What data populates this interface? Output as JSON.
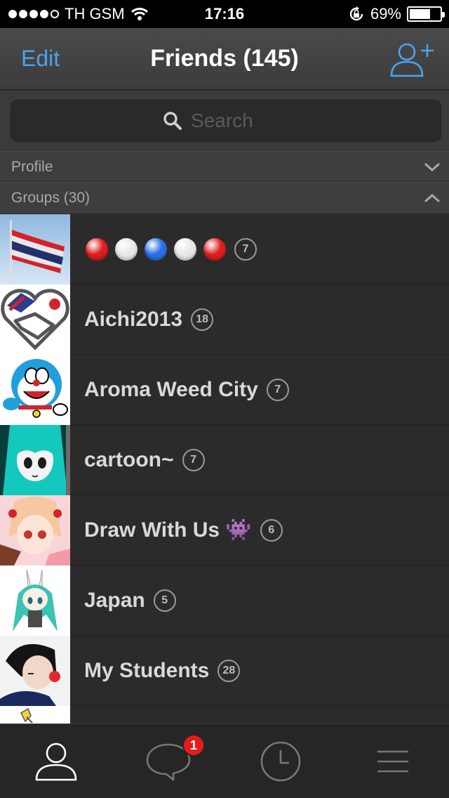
{
  "status_bar": {
    "carrier": "TH GSM",
    "time": "17:16",
    "battery_percent_label": "69%",
    "battery_level": 0.69
  },
  "navbar": {
    "edit_label": "Edit",
    "title": "Friends (145)",
    "add_friend_icon": "add-person-icon"
  },
  "search": {
    "placeholder": "Search",
    "icon": "search-icon"
  },
  "sections": {
    "profile": {
      "label": "Profile",
      "icon": "chevron-down-icon"
    },
    "groups": {
      "label": "Groups (30)",
      "icon": "chevron-up-icon"
    }
  },
  "groups": [
    {
      "title": "",
      "count": "7",
      "ball_colors": [
        "#e21d1d",
        "#e8e8e8",
        "#2b6fe6",
        "#e8e8e8",
        "#e21d1d"
      ]
    },
    {
      "title": "Aichi2013",
      "count": "18"
    },
    {
      "title": "Aroma Weed City",
      "count": "7"
    },
    {
      "title": "cartoon~",
      "count": "7"
    },
    {
      "title": "Draw With Us 👾",
      "count": "6"
    },
    {
      "title": "Japan",
      "count": "5"
    },
    {
      "title": "My Students",
      "count": "28"
    },
    {
      "title": "",
      "count": ""
    }
  ],
  "tabbar": {
    "tabs": [
      {
        "icon": "friends-person-icon"
      },
      {
        "icon": "chat-bubble-icon",
        "badge": "1"
      },
      {
        "icon": "clock-icon"
      },
      {
        "icon": "menu-icon"
      }
    ]
  },
  "colors": {
    "accent": "#4aa3ee",
    "badge": "#e21d1d",
    "background": "#2b2b2b"
  }
}
